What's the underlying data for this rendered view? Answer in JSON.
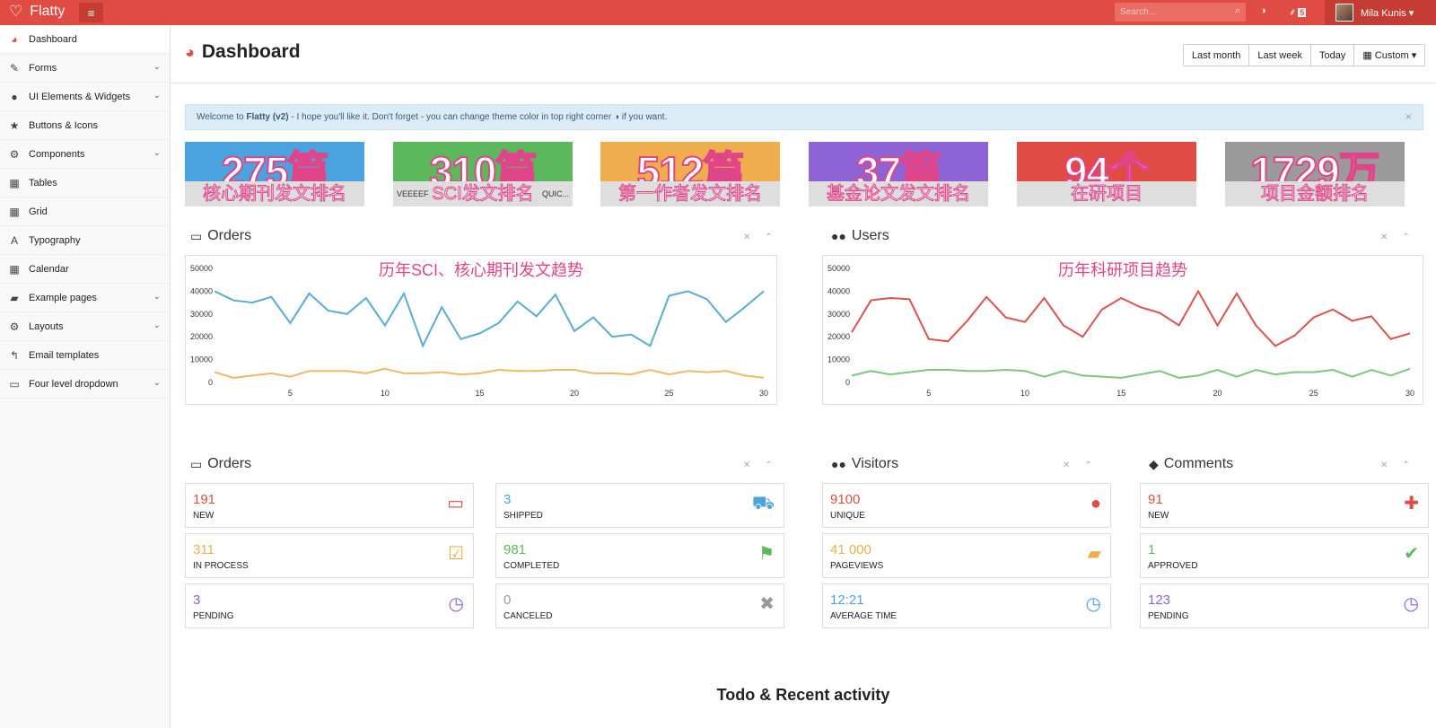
{
  "topbar": {
    "brand": "Flatty",
    "search_placeholder": "Search...",
    "rss_count": "5",
    "user_name": "Mila Kunis ▾"
  },
  "sidebar": {
    "items": [
      {
        "label": "Dashboard",
        "icon": "dashboard-icon",
        "glyph": "◕",
        "chevron": false
      },
      {
        "label": "Forms",
        "icon": "edit-icon",
        "glyph": "✎",
        "chevron": true
      },
      {
        "label": "UI Elements & Widgets",
        "icon": "tint-icon",
        "glyph": "●",
        "chevron": true
      },
      {
        "label": "Buttons & Icons",
        "icon": "star-icon",
        "glyph": "★",
        "chevron": false
      },
      {
        "label": "Components",
        "icon": "cogs-icon",
        "glyph": "⚙",
        "chevron": true
      },
      {
        "label": "Tables",
        "icon": "table-icon",
        "glyph": "▦",
        "chevron": false
      },
      {
        "label": "Grid",
        "icon": "grid-icon",
        "glyph": "▦",
        "chevron": false
      },
      {
        "label": "Typography",
        "icon": "font-icon",
        "glyph": "A",
        "chevron": false
      },
      {
        "label": "Calendar",
        "icon": "calendar-icon",
        "glyph": "▦",
        "chevron": false
      },
      {
        "label": "Example pages",
        "icon": "book-icon",
        "glyph": "▰",
        "chevron": true
      },
      {
        "label": "Layouts",
        "icon": "cog-icon",
        "glyph": "⚙",
        "chevron": true
      },
      {
        "label": "Email templates",
        "icon": "reply-icon",
        "glyph": "↰",
        "chevron": false
      },
      {
        "label": "Four level dropdown",
        "icon": "folder-icon",
        "glyph": "▭",
        "chevron": true
      }
    ]
  },
  "main": {
    "title": "Dashboard",
    "date_buttons": [
      "Last month",
      "Last week",
      "Today",
      "▦ Custom ▾"
    ],
    "alert": {
      "prefix": "Welcome to ",
      "brand": "Flatty (v2)",
      "text": " - I hope you'll like it. Don't forget - you can change theme color in top right corner ◑ if you want.",
      "close": "×"
    },
    "tiles": [
      {
        "number": "275篇",
        "caption": "核心期刊发文排名",
        "color": "#4aa3df"
      },
      {
        "number": "310篇",
        "caption": "SCI发文排名",
        "color": "#5cb85c",
        "left_small": "VEEEEF",
        "right_small": "QUIC..."
      },
      {
        "number": "512篇",
        "caption": "第一作者发文排名",
        "color": "#f0ad4e"
      },
      {
        "number": "37篇",
        "caption": "基金论文发文排名",
        "color": "#8e63d6"
      },
      {
        "number": "94个",
        "caption": "在研项目",
        "color": "#e04b43"
      },
      {
        "number": "1729万",
        "caption": "项目金额排名",
        "color": "#9a9a9a"
      }
    ],
    "orders_panel_title": "Orders",
    "users_panel_title": "Users",
    "orders_chart_title": "历年SCI、核心期刊发文趋势",
    "users_chart_title": "历年科研项目趋势",
    "stats_orders_title": "Orders",
    "stats_visitors_title": "Visitors",
    "stats_comments_title": "Comments",
    "stats": {
      "orders": [
        {
          "value": "191",
          "label": "NEW",
          "color": "#e04b43",
          "icon": "inbox-icon",
          "glyph": "▭"
        },
        {
          "value": "3",
          "label": "SHIPPED",
          "color": "#4aa3df",
          "icon": "truck-icon",
          "glyph": "⛟"
        },
        {
          "value": "311",
          "label": "IN PROCESS",
          "color": "#f0ad4e",
          "icon": "check-square-icon",
          "glyph": "☑"
        },
        {
          "value": "981",
          "label": "COMPLETED",
          "color": "#5cb85c",
          "icon": "flag-icon",
          "glyph": "⚑"
        },
        {
          "value": "3",
          "label": "PENDING",
          "color": "#8e63d6",
          "icon": "clock-icon",
          "glyph": "◷"
        },
        {
          "value": "0",
          "label": "CANCELED",
          "color": "#999999",
          "icon": "times-icon",
          "glyph": "✖"
        }
      ],
      "visitors": [
        {
          "value": "9100",
          "label": "UNIQUE",
          "color": "#e04b43",
          "icon": "user-icon",
          "glyph": "●"
        },
        {
          "value": "41 000",
          "label": "PAGEVIEWS",
          "color": "#f0ad4e",
          "icon": "book-icon",
          "glyph": "▰"
        },
        {
          "value": "12:21",
          "label": "AVERAGE TIME",
          "color": "#4aa3df",
          "icon": "clock-icon",
          "glyph": "◷"
        }
      ],
      "comments": [
        {
          "value": "91",
          "label": "NEW",
          "color": "#e04b43",
          "icon": "plus-icon",
          "glyph": "✚"
        },
        {
          "value": "1",
          "label": "APPROVED",
          "color": "#5cb85c",
          "icon": "check-icon",
          "glyph": "✔"
        },
        {
          "value": "123",
          "label": "PENDING",
          "color": "#8e63d6",
          "icon": "clock-icon",
          "glyph": "◷"
        }
      ]
    },
    "footer_title": "Todo & Recent activity"
  },
  "chart_data": [
    {
      "type": "line",
      "title": "历年SCI、核心期刊发文趋势",
      "ylim": [
        0,
        50000
      ],
      "xlim": [
        1,
        30
      ],
      "yticks": [
        "0",
        "10000",
        "20000",
        "30000",
        "40000",
        "50000"
      ],
      "xticks": [
        "5",
        "10",
        "15",
        "20",
        "25",
        "30"
      ],
      "x": [
        1,
        2,
        3,
        4,
        5,
        6,
        7,
        8,
        9,
        10,
        11,
        12,
        13,
        14,
        15,
        16,
        17,
        18,
        19,
        20,
        21,
        22,
        23,
        24,
        25,
        26,
        27,
        28,
        29,
        30
      ],
      "series": [
        {
          "color": "#5aacd1",
          "values": [
            40000,
            36000,
            35000,
            37500,
            26000,
            39000,
            31500,
            30000,
            37000,
            25000,
            39000,
            16000,
            33000,
            19000,
            21500,
            26000,
            35500,
            29000,
            38500,
            22500,
            28500,
            20000,
            21000,
            16000,
            38000,
            40000,
            36500,
            26500,
            33000,
            40000
          ]
        },
        {
          "color": "#f0b865",
          "values": [
            4500,
            2000,
            3000,
            4000,
            2500,
            5000,
            5000,
            5000,
            4000,
            6000,
            4000,
            4000,
            4500,
            3500,
            4000,
            5500,
            5000,
            5000,
            5500,
            5500,
            4000,
            4000,
            3500,
            5500,
            3500,
            5000,
            4500,
            5000,
            3000,
            2000
          ]
        }
      ]
    },
    {
      "type": "line",
      "title": "历年科研项目趋势",
      "ylim": [
        0,
        50000
      ],
      "xlim": [
        1,
        30
      ],
      "yticks": [
        "0",
        "10000",
        "20000",
        "30000",
        "40000",
        "50000"
      ],
      "xticks": [
        "5",
        "10",
        "15",
        "20",
        "25",
        "30"
      ],
      "x": [
        1,
        2,
        3,
        4,
        5,
        6,
        7,
        8,
        9,
        10,
        11,
        12,
        13,
        14,
        15,
        16,
        17,
        18,
        19,
        20,
        21,
        22,
        23,
        24,
        25,
        26,
        27,
        28,
        29,
        30
      ],
      "series": [
        {
          "color": "#d9534f",
          "values": [
            22000,
            36000,
            37000,
            36500,
            19000,
            18000,
            27000,
            37500,
            28500,
            26500,
            37000,
            25000,
            20000,
            32000,
            37000,
            33000,
            30500,
            25000,
            40000,
            25000,
            39000,
            25000,
            16000,
            20500,
            28500,
            32000,
            27000,
            29000,
            19000,
            21500
          ]
        },
        {
          "color": "#7dc67e",
          "values": [
            3000,
            5000,
            3500,
            4500,
            5500,
            5500,
            5000,
            5000,
            5500,
            5000,
            2500,
            5000,
            3000,
            2500,
            2000,
            3500,
            5000,
            2000,
            3000,
            5500,
            2500,
            5500,
            3500,
            4500,
            4500,
            5500,
            2500,
            5500,
            3000,
            6000
          ]
        }
      ]
    }
  ]
}
